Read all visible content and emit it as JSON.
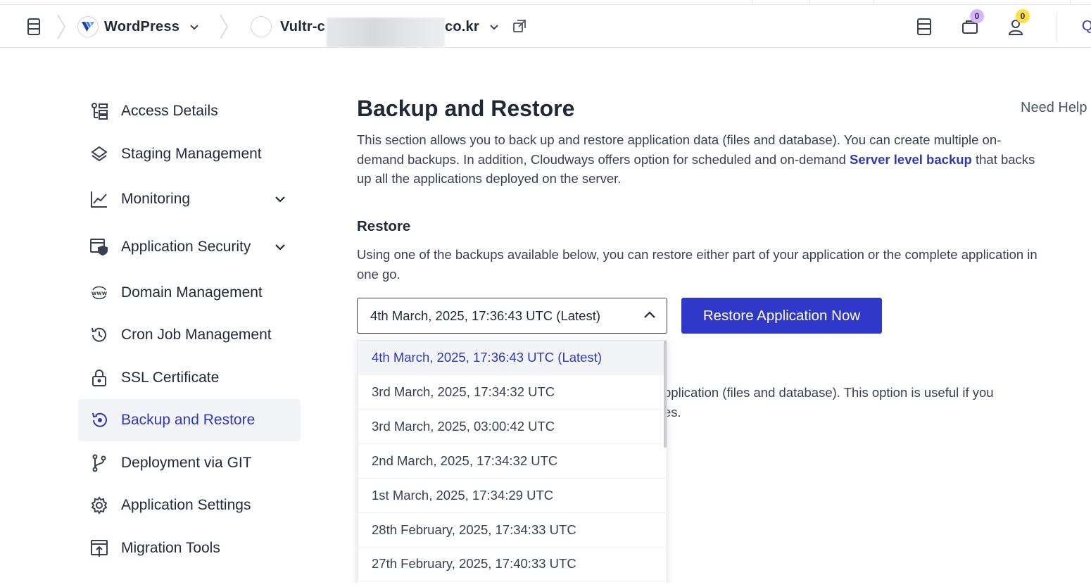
{
  "topbar": {
    "app_name": "WordPress",
    "server_name_prefix": "Vultr-c",
    "server_name_suffix": "co.kr",
    "notifications_count": "0",
    "user_count": "0",
    "right_cutoff_text": "Q"
  },
  "sidebar": {
    "items": [
      {
        "label": "Access Details",
        "icon": "access-details-icon"
      },
      {
        "label": "Staging Management",
        "icon": "layers-icon"
      },
      {
        "label": "Monitoring",
        "icon": "chart-line-icon",
        "expandable": true
      },
      {
        "label": "Application Security",
        "icon": "shield-window-icon",
        "expandable": true
      },
      {
        "label": "Domain Management",
        "icon": "www-globe-icon"
      },
      {
        "label": "Cron Job Management",
        "icon": "history-clock-icon"
      },
      {
        "label": "SSL Certificate",
        "icon": "lock-icon"
      },
      {
        "label": "Backup and Restore",
        "icon": "backup-restore-icon",
        "active": true
      },
      {
        "label": "Deployment via GIT",
        "icon": "git-branch-icon"
      },
      {
        "label": "Application Settings",
        "icon": "gear-icon"
      },
      {
        "label": "Migration Tools",
        "icon": "migration-upload-icon"
      }
    ]
  },
  "main": {
    "title": "Backup and Restore",
    "need_help": "Need Help",
    "intro_part1": "This section allows you to back up and restore application data (files and database). You can create multiple on-demand backups. In addition, Cloudways offers option for scheduled and on-demand ",
    "intro_link": "Server level backup",
    "intro_part2": " that backs up all the applications deployed on the server.",
    "restore": {
      "title": "Restore",
      "description": "Using one of the backups available below, you can restore either part of your application or the complete application in one go.",
      "selected": "4th March, 2025, 17:36:43 UTC (Latest)",
      "button_label": "Restore Application Now"
    },
    "hidden_text_line1": "pplication (files and database). This option is useful if you",
    "hidden_text_line2": "es."
  },
  "dropdown": {
    "options": [
      "4th March, 2025, 17:36:43 UTC (Latest)",
      "3rd March, 2025, 17:34:32 UTC",
      "3rd March, 2025, 03:00:42 UTC",
      "2nd March, 2025, 17:34:32 UTC",
      "1st March, 2025, 17:34:29 UTC",
      "28th February, 2025, 17:34:33 UTC",
      "27th February, 2025, 17:40:33 UTC"
    ]
  },
  "colors": {
    "accent": "#2f38c8",
    "active_text": "#2f38b8",
    "active_bg": "#f3f4f8",
    "badge_purple": "#d8b4fe",
    "badge_yellow": "#fde047"
  }
}
